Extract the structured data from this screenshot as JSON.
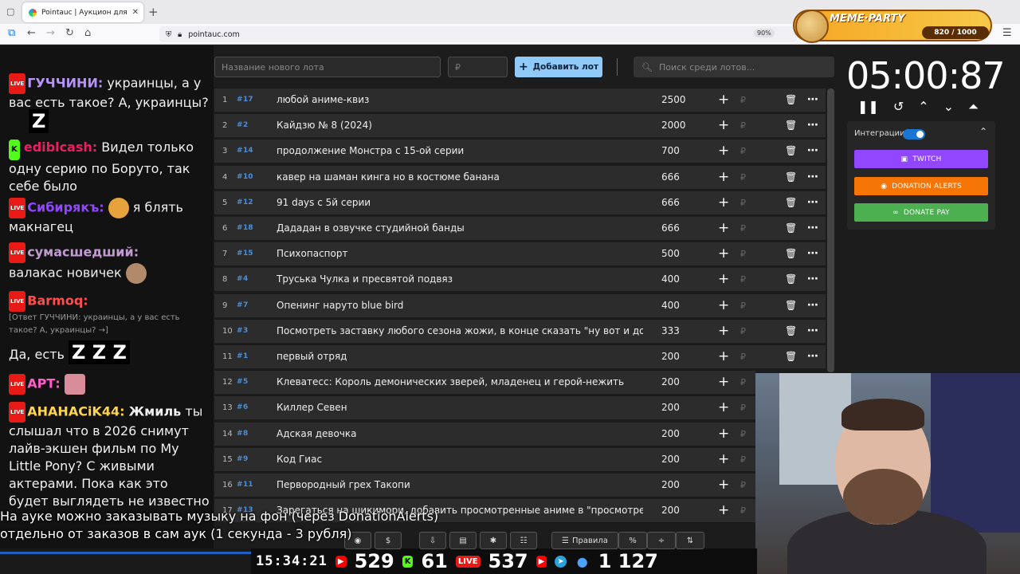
{
  "browser": {
    "tab_title": "Pointauc | Аукцион для стримеров",
    "url": "pointauc.com",
    "zoom": "90%"
  },
  "meme_party": {
    "title": "MEME·PARTY",
    "counter": "820 / 1000"
  },
  "chat": {
    "m1_nick": "ГУЧЧИНИ:",
    "m1_text": "украинцы, а у вас есть такое? А, украинцы?",
    "m1_emote": "Z",
    "m2_nick": "ediblcash:",
    "m2_text": "Видел только одну серию по Боруто, так себе было",
    "m3_nick": "Сибирякъ:",
    "m3_text": "я блять макнагец",
    "m4_nick": "сумасшедший:",
    "m4_text": "валакас новичек",
    "m5_nick": "Barmoq:",
    "m5_reply": "[Ответ ГУЧЧИНИ: украинцы, а у вас есть такое? А, украинцы? →]",
    "m5_text": "Да, есть",
    "m5_emote": "Z Z Z",
    "m6_nick": "АРТ:",
    "m7_nick": "АНАНАСiK44:",
    "m7_text_bold": "Жмиль",
    "m7_text": "ты слышал что в 2026 снимут лайв-экшен фильм по My Little Pony? С живыми актерами. Пока как это будет выглядеть не известно"
  },
  "form": {
    "name_placeholder": "Название нового лота",
    "price_placeholder": "₽",
    "add_label": "Добавить лот",
    "search_placeholder": "Поиск среди лотов..."
  },
  "lots": [
    {
      "n": "1",
      "id": "17",
      "name": "любой аниме-квиз",
      "amount": "2500"
    },
    {
      "n": "2",
      "id": "2",
      "name": "Кайдзю № 8 (2024)",
      "amount": "2000"
    },
    {
      "n": "3",
      "id": "14",
      "name": "продолжение Монстра с 15-ой серии",
      "amount": "700"
    },
    {
      "n": "4",
      "id": "10",
      "name": "кавер на шаман кинга но в костюме банана",
      "amount": "666"
    },
    {
      "n": "5",
      "id": "12",
      "name": "91 days с 5й серии",
      "amount": "666"
    },
    {
      "n": "6",
      "id": "18",
      "name": "Дададан в озвучке студийной банды",
      "amount": "666"
    },
    {
      "n": "7",
      "id": "15",
      "name": "Психопаспорт",
      "amount": "500"
    },
    {
      "n": "8",
      "id": "4",
      "name": "Труська Чулка и пресвятой подвяз",
      "amount": "400"
    },
    {
      "n": "9",
      "id": "7",
      "name": "Опенинг наруто blue bird",
      "amount": "400"
    },
    {
      "n": "10",
      "id": "3",
      "name": "Посмотреть заставку любого сезона жожи, в конце сказать \"ну вот и достаточ",
      "amount": "333"
    },
    {
      "n": "11",
      "id": "1",
      "name": "первый отряд",
      "amount": "200"
    },
    {
      "n": "12",
      "id": "5",
      "name": "Клеватесс: Король демонических зверей, младенец и герой-нежить",
      "amount": "200"
    },
    {
      "n": "13",
      "id": "6",
      "name": "Киллер Севен",
      "amount": "200"
    },
    {
      "n": "14",
      "id": "8",
      "name": "Адская девочка",
      "amount": "200"
    },
    {
      "n": "15",
      "id": "9",
      "name": "Код Гиас",
      "amount": "200"
    },
    {
      "n": "16",
      "id": "11",
      "name": "Первородный грех Такопи",
      "amount": "200"
    },
    {
      "n": "17",
      "id": "13",
      "name": "Зарегаться на шикимори, добавить просмотренные аниме в \"просмотрено\",",
      "amount": "200"
    }
  ],
  "timer": "05:00:87",
  "integrations": {
    "label": "Интеграции",
    "twitch": "TWITCH",
    "donation_alerts": "DONATION ALERTS",
    "donate_pay": "DONATE PAY"
  },
  "note": "На ауке можно заказывать музыку на фон (через DonationAlerts) отдельно от заказов в сам аук (1 секунда - 3 рубля)",
  "toolbar": {
    "rules": "Правила"
  },
  "stats": {
    "time": "15:34:21",
    "youtube": "529",
    "kick": "61",
    "live": "537",
    "viewers": "1 127"
  },
  "colors": {
    "accent": "#90caf9",
    "twitch": "#9146ff",
    "donation_alerts": "#f57507",
    "donate_pay": "#4caf50"
  }
}
